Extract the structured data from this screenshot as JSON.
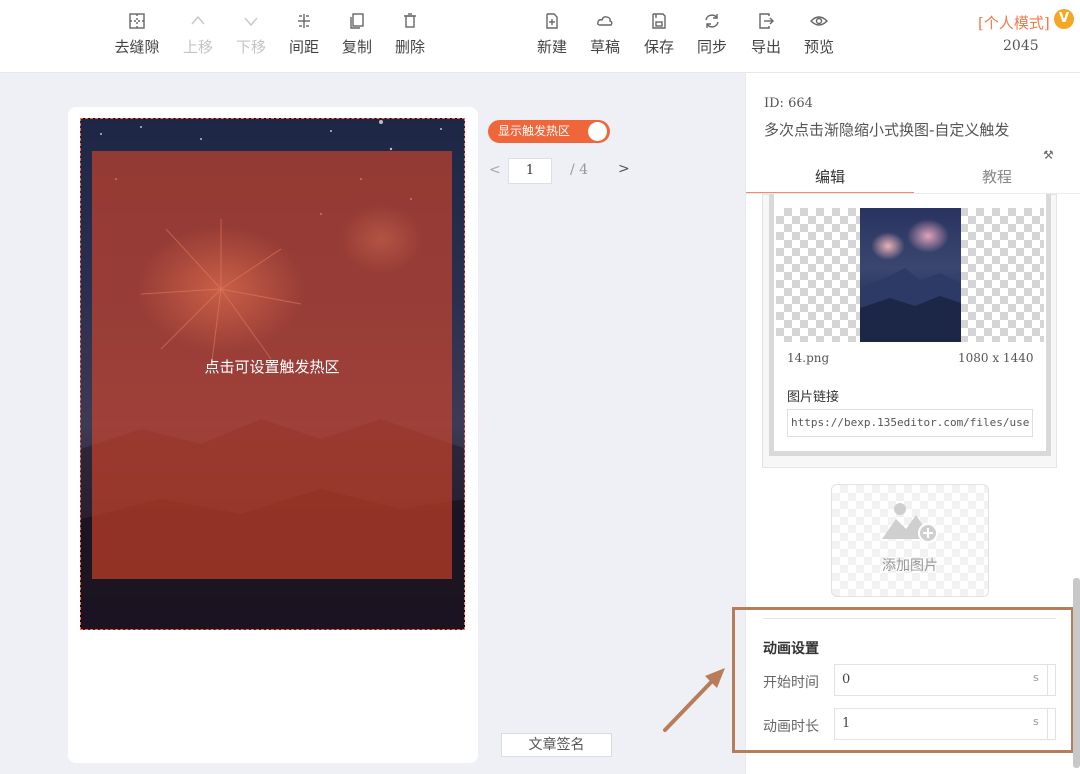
{
  "toolbar": {
    "left_buttons": [
      {
        "icon": "grid-icon",
        "label": "去缝隙"
      },
      {
        "icon": "chevron-up-icon",
        "label": "上移"
      },
      {
        "icon": "chevron-down-icon",
        "label": "下移"
      },
      {
        "icon": "spacing-icon",
        "label": "间距"
      },
      {
        "icon": "copy-icon",
        "label": "复制"
      },
      {
        "icon": "trash-icon",
        "label": "删除"
      }
    ],
    "right_buttons": [
      {
        "icon": "new-file-icon",
        "label": "新建"
      },
      {
        "icon": "cloud-icon",
        "label": "草稿"
      },
      {
        "icon": "save-icon",
        "label": "保存"
      },
      {
        "icon": "sync-icon",
        "label": "同步"
      },
      {
        "icon": "export-icon",
        "label": "导出"
      },
      {
        "icon": "eye-icon",
        "label": "预览"
      }
    ],
    "mode_label": "[个人模式]",
    "mode_number": "2045",
    "badge": "V"
  },
  "canvas": {
    "hotzone_label": "点击可设置触发热区",
    "toggle_label": "显示触发热区",
    "toggle_on": true,
    "pager": {
      "prev": "<",
      "current": "1",
      "total": "/ 4",
      "next": ">"
    },
    "sign_button": "文章签名"
  },
  "panel": {
    "id_text": "ID: 664",
    "title": "多次点击渐隐缩小式换图-自定义触发",
    "tabs": [
      {
        "label": "编辑",
        "active": true
      },
      {
        "label": "教程",
        "active": false
      }
    ],
    "image": {
      "filename": "14.png",
      "dimensions": "1080 x 1440",
      "link_label": "图片链接",
      "link_value": "https://bexp.135editor.com/files/use"
    },
    "add_image_label": "添加图片",
    "animation": {
      "title": "动画设置",
      "start_label": "开始时间",
      "start_value": "0",
      "duration_label": "动画时长",
      "duration_value": "1",
      "unit": "s"
    }
  },
  "colors": {
    "accent": "#f0663b",
    "hotzone": "#dc4628",
    "annotation": "#b77d5a"
  }
}
